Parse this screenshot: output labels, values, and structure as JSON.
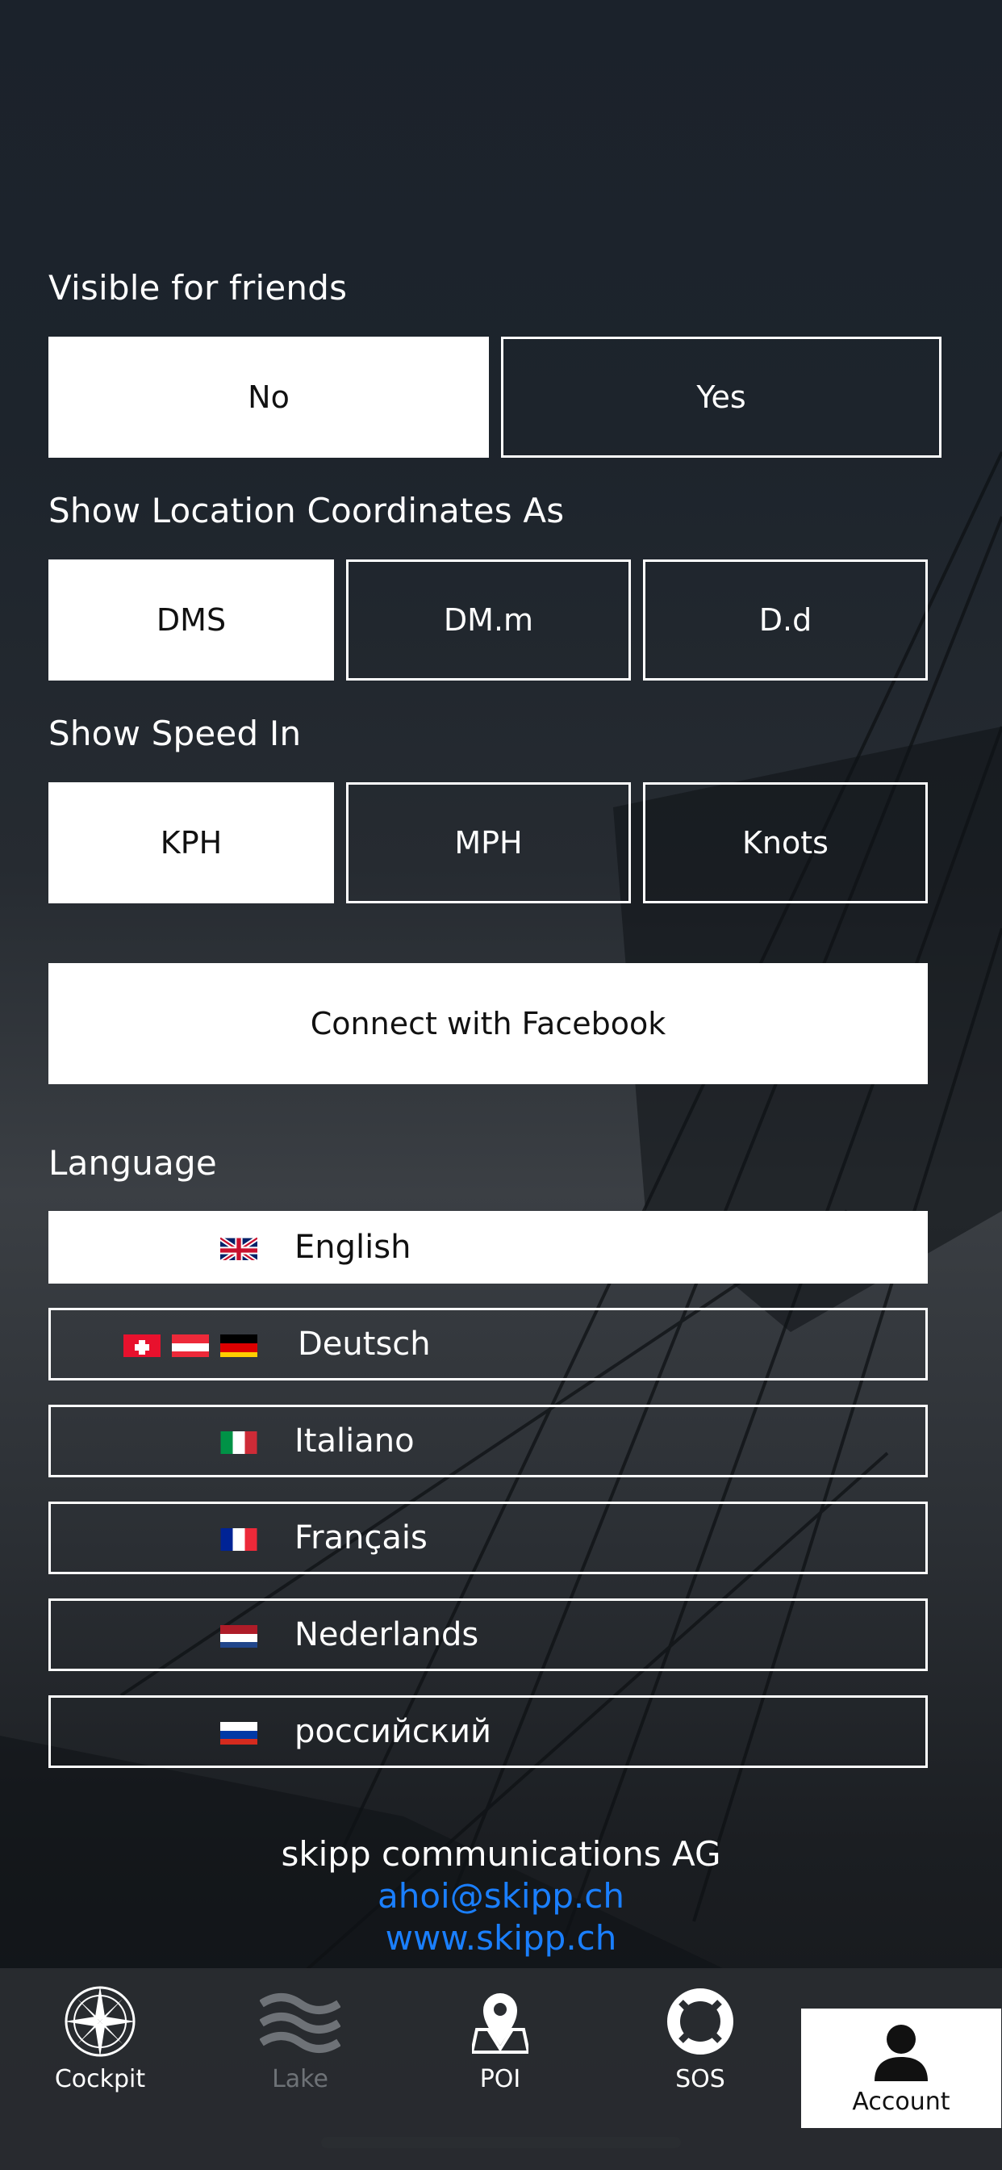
{
  "visibility": {
    "label": "Visible for friends",
    "options": [
      "No",
      "Yes"
    ],
    "selected": "No"
  },
  "coordinates": {
    "label": "Show Location Coordinates As",
    "options": [
      "DMS",
      "DM.m",
      "D.d"
    ],
    "selected": "DMS"
  },
  "speed": {
    "label": "Show Speed In",
    "options": [
      "KPH",
      "MPH",
      "Knots"
    ],
    "selected": "KPH"
  },
  "facebook": {
    "label": "Connect with Facebook"
  },
  "language": {
    "label": "Language",
    "selected": "English",
    "items": [
      {
        "name": "English",
        "flags": [
          "gb-flag-icon"
        ]
      },
      {
        "name": "Deutsch",
        "flags": [
          "ch-flag-icon",
          "at-flag-icon",
          "de-flag-icon"
        ]
      },
      {
        "name": "Italiano",
        "flags": [
          "it-flag-icon"
        ]
      },
      {
        "name": "Français",
        "flags": [
          "fr-flag-icon"
        ]
      },
      {
        "name": "Nederlands",
        "flags": [
          "nl-flag-icon"
        ]
      },
      {
        "name": "российский",
        "flags": [
          "ru-flag-icon"
        ]
      }
    ]
  },
  "footer": {
    "company": "skipp communications AG",
    "email": "ahoi@skipp.ch",
    "website": "www.skipp.ch",
    "link_color": "#1a7fff"
  },
  "tabbar": {
    "active": "Account",
    "tabs": [
      {
        "label": "Cockpit",
        "icon": "compass-icon",
        "enabled": true
      },
      {
        "label": "Lake",
        "icon": "waves-icon",
        "enabled": false
      },
      {
        "label": "POI",
        "icon": "map-pin-icon",
        "enabled": true
      },
      {
        "label": "SOS",
        "icon": "lifebuoy-icon",
        "enabled": true
      },
      {
        "label": "Account",
        "icon": "user-icon",
        "enabled": true
      }
    ]
  }
}
